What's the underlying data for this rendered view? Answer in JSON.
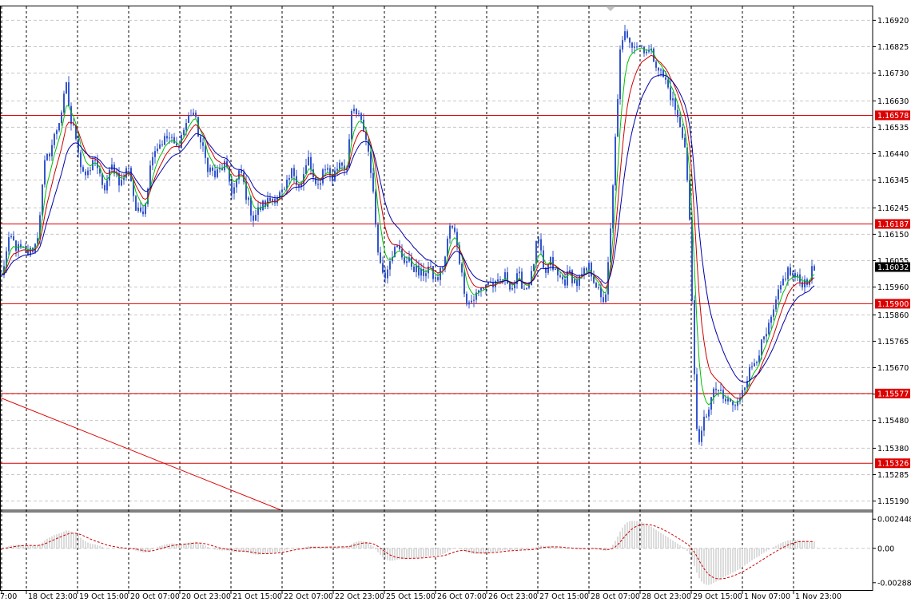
{
  "chart_data": {
    "type": "candlestick",
    "title": "",
    "main_price_scale": {
      "ticks": [
        "1.16920",
        "1.16825",
        "1.16730",
        "1.16630",
        "1.16535",
        "1.16440",
        "1.16345",
        "1.16245",
        "1.16150",
        "1.16055",
        "1.15960",
        "1.15860",
        "1.15765",
        "1.15670",
        "1.15575",
        "1.15480",
        "1.15380",
        "1.15285",
        "1.15190"
      ],
      "range": [
        1.1516,
        1.1697
      ]
    },
    "time_axis_labels": [
      "7:00",
      "18 Oct 23:00",
      "19 Oct 15:00",
      "20 Oct 07:00",
      "20 Oct 23:00",
      "21 Oct 15:00",
      "22 Oct 07:00",
      "22 Oct 23:00",
      "25 Oct 15:00",
      "26 Oct 07:00",
      "26 Oct 23:00",
      "27 Oct 15:00",
      "28 Oct 07:00",
      "28 Oct 23:00",
      "29 Oct 15:00",
      "1 Nov 07:00",
      "1 Nov 23:00"
    ],
    "horizontal_levels": [
      {
        "value": 1.16578,
        "label": "1.16578"
      },
      {
        "value": 1.16187,
        "label": "1.16187"
      },
      {
        "value": 1.159,
        "label": "1.15900"
      },
      {
        "value": 1.15577,
        "label": "1.15577"
      },
      {
        "value": 1.15326,
        "label": "1.15326"
      }
    ],
    "current_price": {
      "value": 1.16032,
      "label": "1.16032"
    },
    "price_path": [
      [
        0,
        1.1598
      ],
      [
        5,
        1.1606
      ],
      [
        12,
        1.1614
      ],
      [
        20,
        1.161
      ],
      [
        35,
        1.1608
      ],
      [
        45,
        1.1612
      ],
      [
        55,
        1.164
      ],
      [
        65,
        1.1648
      ],
      [
        75,
        1.1658
      ],
      [
        82,
        1.1668
      ],
      [
        88,
        1.1655
      ],
      [
        95,
        1.165
      ],
      [
        100,
        1.164
      ],
      [
        108,
        1.1635
      ],
      [
        118,
        1.1643
      ],
      [
        128,
        1.163
      ],
      [
        140,
        1.164
      ],
      [
        150,
        1.1633
      ],
      [
        160,
        1.164
      ],
      [
        170,
        1.1622
      ],
      [
        180,
        1.1625
      ],
      [
        190,
        1.1645
      ],
      [
        200,
        1.1648
      ],
      [
        210,
        1.165
      ],
      [
        220,
        1.1646
      ],
      [
        232,
        1.1655
      ],
      [
        240,
        1.166
      ],
      [
        250,
        1.1648
      ],
      [
        258,
        1.164
      ],
      [
        268,
        1.1636
      ],
      [
        280,
        1.164
      ],
      [
        290,
        1.163
      ],
      [
        300,
        1.1638
      ],
      [
        308,
        1.1628
      ],
      [
        316,
        1.1621
      ],
      [
        326,
        1.1625
      ],
      [
        340,
        1.1628
      ],
      [
        355,
        1.163
      ],
      [
        365,
        1.1638
      ],
      [
        375,
        1.1632
      ],
      [
        385,
        1.1642
      ],
      [
        395,
        1.163
      ],
      [
        405,
        1.164
      ],
      [
        415,
        1.1635
      ],
      [
        425,
        1.1642
      ],
      [
        432,
        1.1638
      ],
      [
        440,
        1.166
      ],
      [
        448,
        1.1657
      ],
      [
        455,
        1.1652
      ],
      [
        462,
        1.1642
      ],
      [
        468,
        1.1622
      ],
      [
        474,
        1.1605
      ],
      [
        480,
        1.16
      ],
      [
        488,
        1.1608
      ],
      [
        496,
        1.161
      ],
      [
        505,
        1.1606
      ],
      [
        515,
        1.1604
      ],
      [
        525,
        1.16
      ],
      [
        535,
        1.1603
      ],
      [
        545,
        1.1598
      ],
      [
        555,
        1.1605
      ],
      [
        562,
        1.1618
      ],
      [
        570,
        1.1614
      ],
      [
        577,
        1.16
      ],
      [
        584,
        1.159
      ],
      [
        592,
        1.1592
      ],
      [
        600,
        1.1595
      ],
      [
        610,
        1.1598
      ],
      [
        620,
        1.1596
      ],
      [
        630,
        1.16
      ],
      [
        640,
        1.1596
      ],
      [
        648,
        1.16
      ],
      [
        656,
        1.1595
      ],
      [
        664,
        1.16
      ],
      [
        672,
        1.1614
      ],
      [
        680,
        1.16
      ],
      [
        688,
        1.1605
      ],
      [
        696,
        1.16
      ],
      [
        705,
        1.1598
      ],
      [
        712,
        1.1601
      ],
      [
        720,
        1.1597
      ],
      [
        728,
        1.16
      ],
      [
        736,
        1.1603
      ],
      [
        744,
        1.1598
      ],
      [
        752,
        1.159
      ],
      [
        758,
        1.1595
      ],
      [
        764,
        1.162
      ],
      [
        770,
        1.1655
      ],
      [
        775,
        1.168
      ],
      [
        782,
        1.1688
      ],
      [
        790,
        1.1684
      ],
      [
        798,
        1.1683
      ],
      [
        806,
        1.1682
      ],
      [
        814,
        1.168
      ],
      [
        820,
        1.1677
      ],
      [
        826,
        1.1673
      ],
      [
        832,
        1.167
      ],
      [
        838,
        1.1665
      ],
      [
        844,
        1.166
      ],
      [
        850,
        1.1653
      ],
      [
        856,
        1.1648
      ],
      [
        862,
        1.162
      ],
      [
        866,
        1.158
      ],
      [
        870,
        1.155
      ],
      [
        874,
        1.1538
      ],
      [
        880,
        1.1548
      ],
      [
        888,
        1.1555
      ],
      [
        896,
        1.156
      ],
      [
        904,
        1.1555
      ],
      [
        912,
        1.1555
      ],
      [
        920,
        1.1552
      ],
      [
        928,
        1.156
      ],
      [
        936,
        1.1565
      ],
      [
        944,
        1.157
      ],
      [
        952,
        1.1575
      ],
      [
        960,
        1.158
      ],
      [
        968,
        1.1588
      ],
      [
        976,
        1.1596
      ],
      [
        984,
        1.1602
      ],
      [
        992,
        1.16
      ],
      [
        1000,
        1.1598
      ],
      [
        1008,
        1.1598
      ],
      [
        1014,
        1.1601
      ],
      [
        1020,
        1.1603
      ]
    ],
    "moving_averages": [
      {
        "color": "#00c000",
        "period_bars": 5
      },
      {
        "color": "#cc0000",
        "period_bars": 9
      },
      {
        "color": "#0000aa",
        "period_bars": 16
      }
    ],
    "oscillator": {
      "ticks": [
        "0.002448",
        "0.00",
        "-0.002885"
      ],
      "range": [
        -0.0033,
        0.003
      ],
      "histogram_color": "#b8b8b8",
      "signal_color": "#cc0000"
    },
    "colors": {
      "background": "#ffffff",
      "grid": "#c8c8c8",
      "candles": "#3355cc",
      "levels": "#dd0000",
      "level_tag": "#dd0000",
      "current_tag": "#000000"
    }
  }
}
